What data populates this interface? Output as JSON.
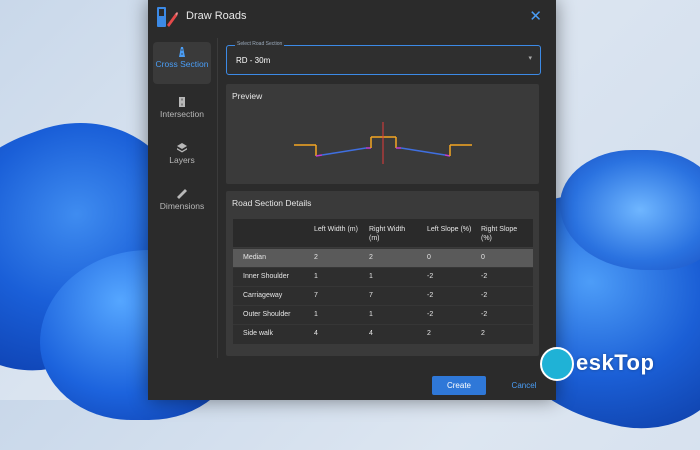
{
  "window": {
    "title": "Draw Roads"
  },
  "sidebar": {
    "items": [
      {
        "label": "Cross Section",
        "icon": "road-icon",
        "active": true
      },
      {
        "label": "Intersection",
        "icon": "intersection-icon",
        "active": false
      },
      {
        "label": "Layers",
        "icon": "layers-icon",
        "active": false
      },
      {
        "label": "Dimensions",
        "icon": "ruler-icon",
        "active": false
      }
    ]
  },
  "section_select": {
    "caption": "Select Road Section",
    "value": "RD - 30m"
  },
  "preview": {
    "title": "Preview"
  },
  "details": {
    "title": "Road Section Details",
    "columns": [
      "",
      "Left Width (m)",
      "Right Width (m)",
      "Left Slope (%)",
      "Right Slope (%)"
    ],
    "rows": [
      [
        "Median",
        "2",
        "2",
        "0",
        "0"
      ],
      [
        "Inner Shoulder",
        "1",
        "1",
        "-2",
        "-2"
      ],
      [
        "Carriageway",
        "7",
        "7",
        "-2",
        "-2"
      ],
      [
        "Outer Shoulder",
        "1",
        "1",
        "-2",
        "-2"
      ],
      [
        "Side walk",
        "4",
        "4",
        "2",
        "2"
      ]
    ],
    "selected_row": 0
  },
  "buttons": {
    "create": "Create",
    "cancel": "Cancel"
  },
  "watermark": {
    "text": "eskTop"
  },
  "colors": {
    "accent": "#2f78d8",
    "link": "#4a9df5",
    "preview_orange": "#f5a623",
    "preview_blue": "#3f6fe0",
    "preview_magenta": "#c23bd4",
    "preview_red": "#e23b3b"
  }
}
